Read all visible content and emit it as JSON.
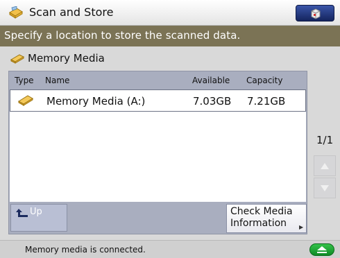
{
  "title_bar": {
    "title": "Scan and Store",
    "function_icon": "scan-and-store-icon",
    "top_button_icon": "system-monitor-icon"
  },
  "instruction": "Specify a location to store the scanned data.",
  "location": {
    "label": "Memory Media",
    "icon": "memory-media-icon"
  },
  "list": {
    "columns": [
      "Type",
      "Name",
      "Available",
      "Capacity"
    ],
    "rows": [
      {
        "type_icon": "memory-media-icon",
        "name": "Memory Media (A:)",
        "available": "7.03GB",
        "capacity": "7.21GB"
      }
    ]
  },
  "buttons": {
    "up_label": "Up",
    "check_media_label": "Check Media\nInformation"
  },
  "pagination": {
    "label": "1/1"
  },
  "status": {
    "message": "Memory media is connected.",
    "eject_icon": "eject-icon"
  },
  "colors": {
    "instruction_bg": "#7b7355",
    "list_frame": "#a9aebf",
    "eject_green": "#1aa032",
    "title_button": "#1e2f6e"
  }
}
